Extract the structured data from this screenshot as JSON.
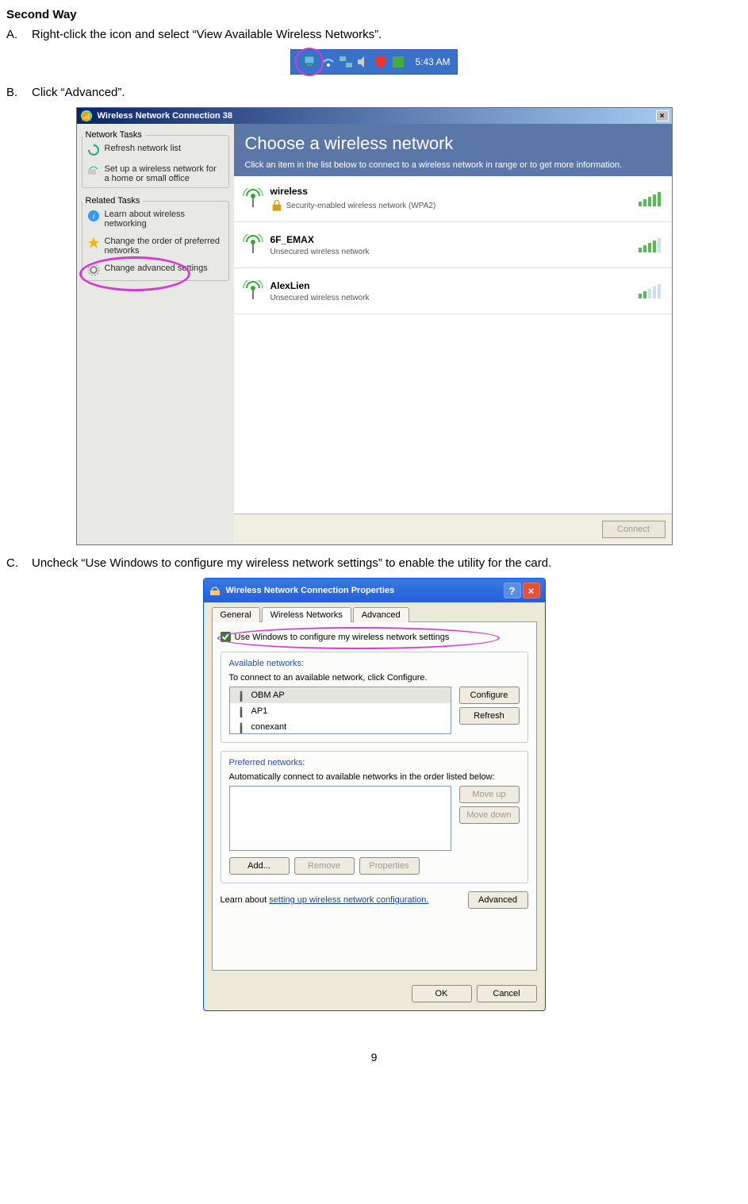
{
  "heading": "Second Way",
  "stepA": {
    "letter": "A.",
    "text": "Right-click the icon and select “View Available Wireless Networks”."
  },
  "stepB": {
    "letter": "B.",
    "text": "Click “Advanced”."
  },
  "stepC": {
    "letter": "C.",
    "text": "Uncheck “Use Windows to configure my wireless network settings” to enable the utility for the card."
  },
  "systray": {
    "time": "5:43 AM"
  },
  "win1": {
    "title": "Wireless Network Connection 38",
    "leftGroups": {
      "networkTasks": {
        "legend": "Network Tasks",
        "items": [
          "Refresh network list",
          "Set up a wireless network for a home or small office"
        ]
      },
      "relatedTasks": {
        "legend": "Related Tasks",
        "items": [
          "Learn about wireless networking",
          "Change the order of preferred networks",
          "Change advanced settings"
        ]
      }
    },
    "banner": {
      "title": "Choose a wireless network",
      "sub": "Click an item in the list below to connect to a wireless network in range or to get more information."
    },
    "networks": [
      {
        "name": "wireless",
        "sub": "Security-enabled wireless network (WPA2)",
        "lockIcon": true,
        "signalStrong": true
      },
      {
        "name": "6F_EMAX",
        "sub": "Unsecured wireless network",
        "lockIcon": false,
        "signalStrong": true
      },
      {
        "name": "AlexLien",
        "sub": "Unsecured wireless network",
        "lockIcon": false,
        "signalStrong": false
      }
    ],
    "connect": "Connect"
  },
  "win2": {
    "title": "Wireless Network Connection Properties",
    "tabs": [
      "General",
      "Wireless Networks",
      "Advanced"
    ],
    "checkbox": "Use Windows to configure my wireless network settings",
    "avail": {
      "title": "Available networks:",
      "sub": "To connect to an available network, click Configure.",
      "items": [
        "OBM AP",
        "AP1",
        "conexant"
      ],
      "configure": "Configure",
      "refresh": "Refresh"
    },
    "pref": {
      "title": "Preferred networks:",
      "sub": "Automatically connect to available networks in the order listed below:",
      "moveup": "Move up",
      "movedown": "Move down",
      "add": "Add...",
      "remove": "Remove",
      "properties": "Properties"
    },
    "learnPrefix": "Learn about ",
    "learnLink": "setting up wireless network configuration.",
    "advanced": "Advanced",
    "ok": "OK",
    "cancel": "Cancel"
  },
  "pageNumber": "9"
}
